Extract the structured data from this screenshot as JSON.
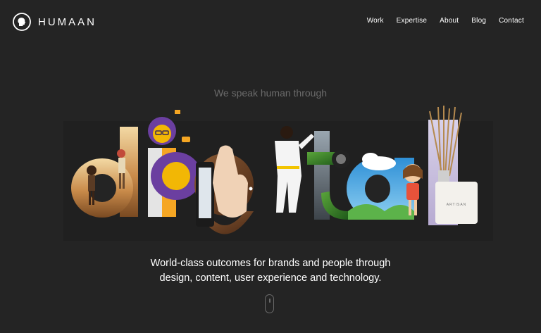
{
  "brand": {
    "name": "HUMAAN"
  },
  "nav": {
    "items": [
      {
        "label": "Work"
      },
      {
        "label": "Expertise"
      },
      {
        "label": "About"
      },
      {
        "label": "Blog"
      },
      {
        "label": "Contact"
      }
    ]
  },
  "hero": {
    "tagline": "We speak human through",
    "headline_word": "digital",
    "subtitle_line1": "World-class outcomes for brands and people through",
    "subtitle_line2": "design, content, user experience and technology.",
    "product_label": "ARTISAN"
  },
  "colors": {
    "background": "#242424",
    "text": "#ffffff",
    "muted": "#6b6b6b",
    "purple": "#6b3fa0",
    "orange": "#f5a623"
  },
  "icons": {
    "logo": "human-head-icon",
    "scroll": "mouse-scroll-icon"
  }
}
